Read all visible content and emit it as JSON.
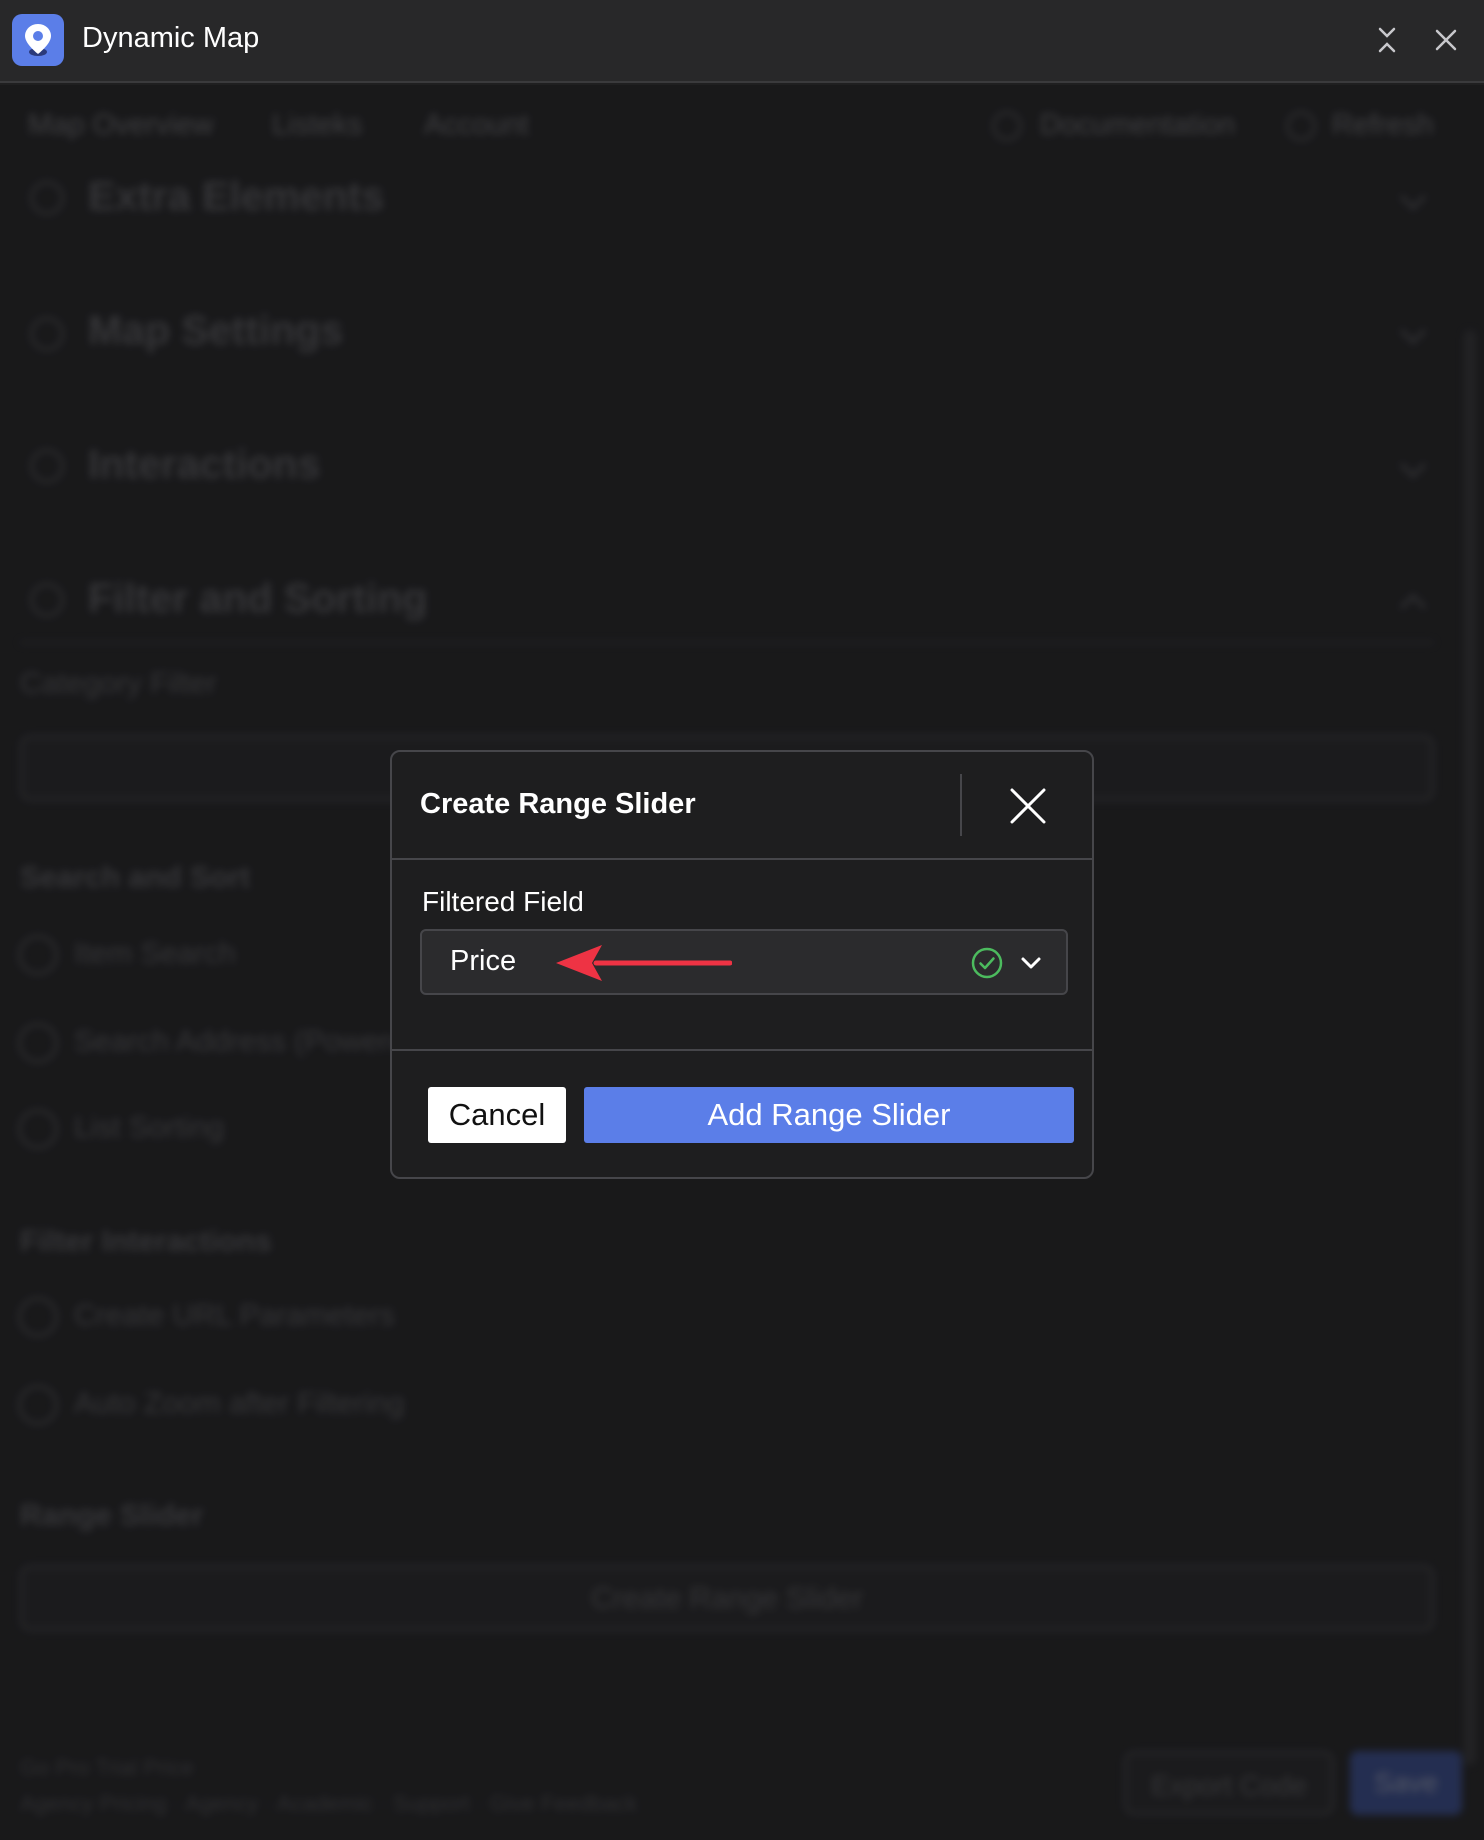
{
  "app": {
    "title": "Dynamic Map",
    "icon": "map-pin-icon",
    "accent_color": "#5b7ee8"
  },
  "background": {
    "nav": {
      "left_items": [
        "Map Overview",
        "Listeks",
        "Account"
      ],
      "documentation_label": "Documentation",
      "refresh_label": "Refresh"
    },
    "sections": [
      {
        "label": "Extra Elements",
        "icon": "puzzle-icon",
        "expanded": false
      },
      {
        "label": "Map Settings",
        "icon": "settings-icon",
        "expanded": false
      },
      {
        "label": "Interactions",
        "icon": "pointer-icon",
        "expanded": false
      },
      {
        "label": "Filter and Sorting",
        "icon": "filter-icon",
        "expanded": true
      }
    ],
    "category_filter_label": "Category Filter",
    "search_and_sort": {
      "heading": "Search and Sort",
      "items": [
        "Item Search",
        "Search Address (Powered",
        "List Sorting"
      ]
    },
    "filter_interactions": {
      "heading": "Filter Interactions",
      "items": [
        "Create URL Parameters",
        "Auto Zoom after Filtering"
      ]
    },
    "range_slider": {
      "heading": "Range Slider",
      "button_label": "Create Range Slider"
    },
    "footer": {
      "line1": "Go Pro Trial Price",
      "line2": "Agency Pricing · Agency · Academic · Support · Give Feedback",
      "export_label": "Export Code",
      "save_label": "Save"
    }
  },
  "modal": {
    "title": "Create Range Slider",
    "field_label": "Filtered Field",
    "selected_value": "Price",
    "valid": true,
    "valid_color": "#4cbb5e",
    "arrow_color": "#ee3344",
    "cancel_label": "Cancel",
    "submit_label": "Add Range Slider"
  }
}
